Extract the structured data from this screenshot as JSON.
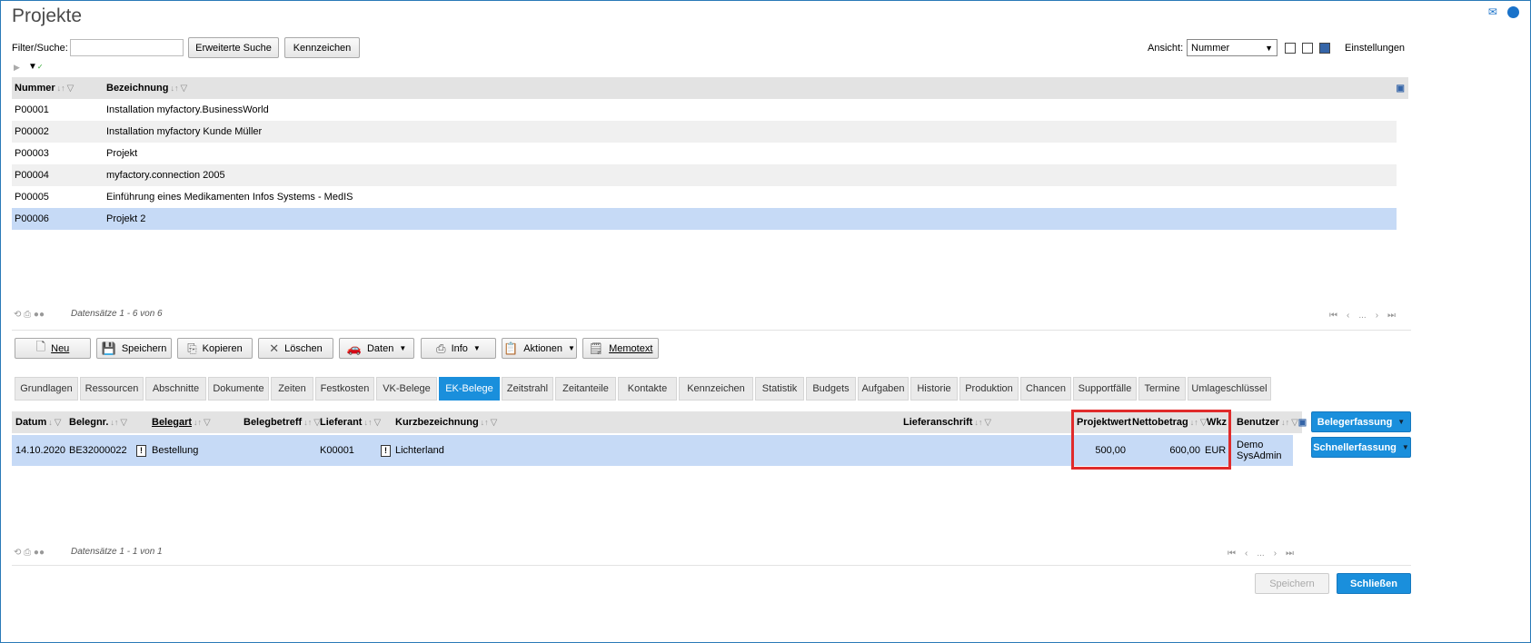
{
  "page": {
    "title": "Projekte"
  },
  "filter": {
    "label": "Filter/Suche:",
    "value": "",
    "advanced_search": "Erweiterte Suche",
    "tags": "Kennzeichen"
  },
  "view": {
    "label": "Ansicht:",
    "selected": "Nummer",
    "settings": "Einstellungen"
  },
  "projects_grid": {
    "columns": [
      "Nummer",
      "Bezeichnung"
    ],
    "rows": [
      [
        "P00001",
        "Installation myfactory.BusinessWorld"
      ],
      [
        "P00002",
        "Installation myfactory Kunde Müller"
      ],
      [
        "P00003",
        "Projekt"
      ],
      [
        "P00004",
        "myfactory.connection 2005"
      ],
      [
        "P00005",
        "Einführung eines Medikamenten Infos Systems - MedIS"
      ],
      [
        "P00006",
        "Projekt 2"
      ]
    ],
    "selected_row": 5,
    "status": "Datensätze 1 - 6 von 6"
  },
  "toolbar": {
    "new": "Neu",
    "save": "Speichern",
    "copy": "Kopieren",
    "delete": "Löschen",
    "data": "Daten",
    "info": "Info",
    "actions": "Aktionen",
    "memo": "Memotext"
  },
  "tabs": [
    "Grundlagen",
    "Ressourcen",
    "Abschnitte",
    "Dokumente",
    "Zeiten",
    "Festkosten",
    "VK-Belege",
    "EK-Belege",
    "Zeitstrahl",
    "Zeitanteile",
    "Kontakte",
    "Kennzeichen",
    "Statistik",
    "Budgets",
    "Aufgaben",
    "Historie",
    "Produktion",
    "Chancen",
    "Supportfälle",
    "Termine",
    "Umlageschlüssel"
  ],
  "active_tab": "EK-Belege",
  "docs_grid": {
    "columns": {
      "datum": "Datum",
      "belegnr": "Belegnr.",
      "belegart": "Belegart",
      "belegbetreff": "Belegbetreff",
      "lieferant": "Lieferant",
      "kurzbezeichnung": "Kurzbezeichnung",
      "lieferanschrift": "Lieferanschrift",
      "projektwert": "Projektwert",
      "nettobetrag": "Nettobetrag",
      "wkz": "Wkz",
      "benutzer": "Benutzer"
    },
    "row": {
      "datum": "14.10.2020",
      "belegnr": "BE32000022",
      "belegart": "Bestellung",
      "belegbetreff": "",
      "lieferant": "K00001",
      "kurzbezeichnung": "Lichterland",
      "lieferanschrift": "",
      "projektwert": "500,00",
      "nettobetrag": "600,00",
      "wkz": "EUR",
      "benutzer_line1": "Demo",
      "benutzer_line2": "SysAdmin"
    },
    "status": "Datensätze 1 - 1 von 1",
    "btn_entry": "Belegerfassung",
    "btn_quick": "Schnellerfassung"
  },
  "footer": {
    "save": "Speichern",
    "close": "Schließen"
  },
  "colors": {
    "accent": "#1a8fdc",
    "selected_row": "#c6daf6",
    "highlight": "#e02b2b"
  }
}
